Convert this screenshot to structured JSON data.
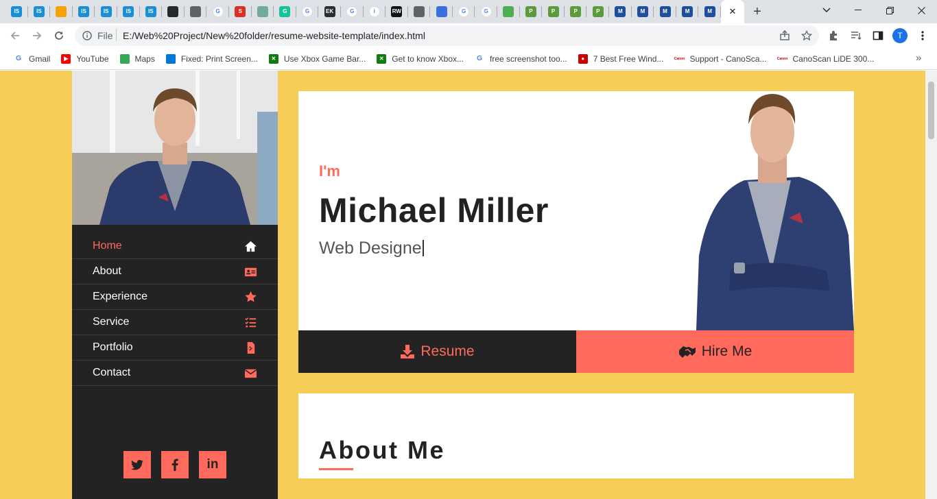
{
  "colors": {
    "accent": "#ff6a5c",
    "page_bg": "#f6cd57",
    "sidebar_bg": "#232323"
  },
  "browser": {
    "tabs": [
      {
        "icon": "is-icon",
        "color": "#1a8fd6",
        "text": "IS"
      },
      {
        "icon": "is-icon",
        "color": "#1a8fd6",
        "text": "IS"
      },
      {
        "icon": "pinwheel-icon",
        "color": "#f4a300",
        "text": ""
      },
      {
        "icon": "is-icon",
        "color": "#1a8fd6",
        "text": "IS"
      },
      {
        "icon": "is-icon",
        "color": "#1a8fd6",
        "text": "IS"
      },
      {
        "icon": "is-icon",
        "color": "#1a8fd6",
        "text": "IS"
      },
      {
        "icon": "is-icon",
        "color": "#1a8fd6",
        "text": "IS"
      },
      {
        "icon": "github-icon",
        "color": "#24292e",
        "text": ""
      },
      {
        "icon": "globe-icon",
        "color": "#5f6368",
        "text": ""
      },
      {
        "icon": "google-icon",
        "color": "#ffffff",
        "text": "G"
      },
      {
        "icon": "s-icon",
        "color": "#d93025",
        "text": "S"
      },
      {
        "icon": "chatgpt-icon",
        "color": "#74aa9c",
        "text": ""
      },
      {
        "icon": "grammarly-icon",
        "color": "#15c39a",
        "text": "G"
      },
      {
        "icon": "google-icon",
        "color": "#ffffff",
        "text": "G"
      },
      {
        "icon": "ek-icon",
        "color": "#2d2d2d",
        "text": "EK"
      },
      {
        "icon": "google-icon",
        "color": "#ffffff",
        "text": "G"
      },
      {
        "icon": "info-icon",
        "color": "#ffffff",
        "text": "i"
      },
      {
        "icon": "rw-icon",
        "color": "#111111",
        "text": "RW"
      },
      {
        "icon": "globe-icon",
        "color": "#5f6368",
        "text": ""
      },
      {
        "icon": "shield-icon",
        "color": "#3b6fe0",
        "text": ""
      },
      {
        "icon": "google-icon",
        "color": "#ffffff",
        "text": "G"
      },
      {
        "icon": "google-icon",
        "color": "#ffffff",
        "text": "G"
      },
      {
        "icon": "image-icon",
        "color": "#4caf50",
        "text": ""
      },
      {
        "icon": "p-icon",
        "color": "#5b9b3c",
        "text": "P"
      },
      {
        "icon": "p-icon",
        "color": "#5b9b3c",
        "text": "P"
      },
      {
        "icon": "p-icon",
        "color": "#5b9b3c",
        "text": "P"
      },
      {
        "icon": "p-icon",
        "color": "#5b9b3c",
        "text": "P"
      },
      {
        "icon": "m-icon",
        "color": "#1f4e9c",
        "text": "M"
      },
      {
        "icon": "m-icon",
        "color": "#1f4e9c",
        "text": "M"
      },
      {
        "icon": "m-icon",
        "color": "#1f4e9c",
        "text": "M"
      },
      {
        "icon": "m-icon",
        "color": "#1f4e9c",
        "text": "M"
      },
      {
        "icon": "m-icon",
        "color": "#1f4e9c",
        "text": "M"
      }
    ],
    "active_tab_close": "✕",
    "new_tab": "+",
    "address": {
      "file_label": "File",
      "url": "E:/Web%20Project/New%20folder/resume-website-template/index.html"
    },
    "profile_initial": "T",
    "bookmarks": [
      {
        "label": "Gmail",
        "icon": "google-icon",
        "color": "#ffffff",
        "text": "G"
      },
      {
        "label": "YouTube",
        "icon": "youtube-icon",
        "color": "#ff0000",
        "text": "▶"
      },
      {
        "label": "Maps",
        "icon": "maps-icon",
        "color": "#34a853",
        "text": ""
      },
      {
        "label": "Fixed: Print Screen...",
        "icon": "windows-icon",
        "color": "#0078d4",
        "text": ""
      },
      {
        "label": "Use Xbox Game Bar...",
        "icon": "xbox-icon",
        "color": "#107c10",
        "text": "✕"
      },
      {
        "label": "Get to know Xbox...",
        "icon": "xbox-icon",
        "color": "#107c10",
        "text": "✕"
      },
      {
        "label": "free screenshot too...",
        "icon": "google-icon",
        "color": "#ffffff",
        "text": "G"
      },
      {
        "label": "7 Best Free Wind...",
        "icon": "trophy-icon",
        "color": "#cc0000",
        "text": "●"
      },
      {
        "label": "Support - CanoSca...",
        "icon": "canon-icon",
        "color": "#ffffff",
        "text": "Canon"
      },
      {
        "label": "CanoScan LiDE 300...",
        "icon": "canon-icon",
        "color": "#ffffff",
        "text": "Canon"
      }
    ]
  },
  "sidebar": {
    "nav": [
      {
        "label": "Home",
        "icon": "home-icon",
        "active": true
      },
      {
        "label": "About",
        "icon": "id-card-icon",
        "active": false
      },
      {
        "label": "Experience",
        "icon": "star-icon",
        "active": false
      },
      {
        "label": "Service",
        "icon": "list-check-icon",
        "active": false
      },
      {
        "label": "Portfolio",
        "icon": "file-icon",
        "active": false
      },
      {
        "label": "Contact",
        "icon": "envelope-icon",
        "active": false
      }
    ],
    "social": [
      {
        "name": "twitter",
        "icon": "twitter-icon"
      },
      {
        "name": "facebook",
        "icon": "facebook-icon"
      },
      {
        "name": "linkedin",
        "icon": "linkedin-icon",
        "text": "in"
      }
    ]
  },
  "hero": {
    "greeting": "I'm",
    "name": "Michael Miller",
    "role": "Web Designe",
    "resume_label": "Resume",
    "hire_label": "Hire Me"
  },
  "about": {
    "title": "About Me"
  }
}
